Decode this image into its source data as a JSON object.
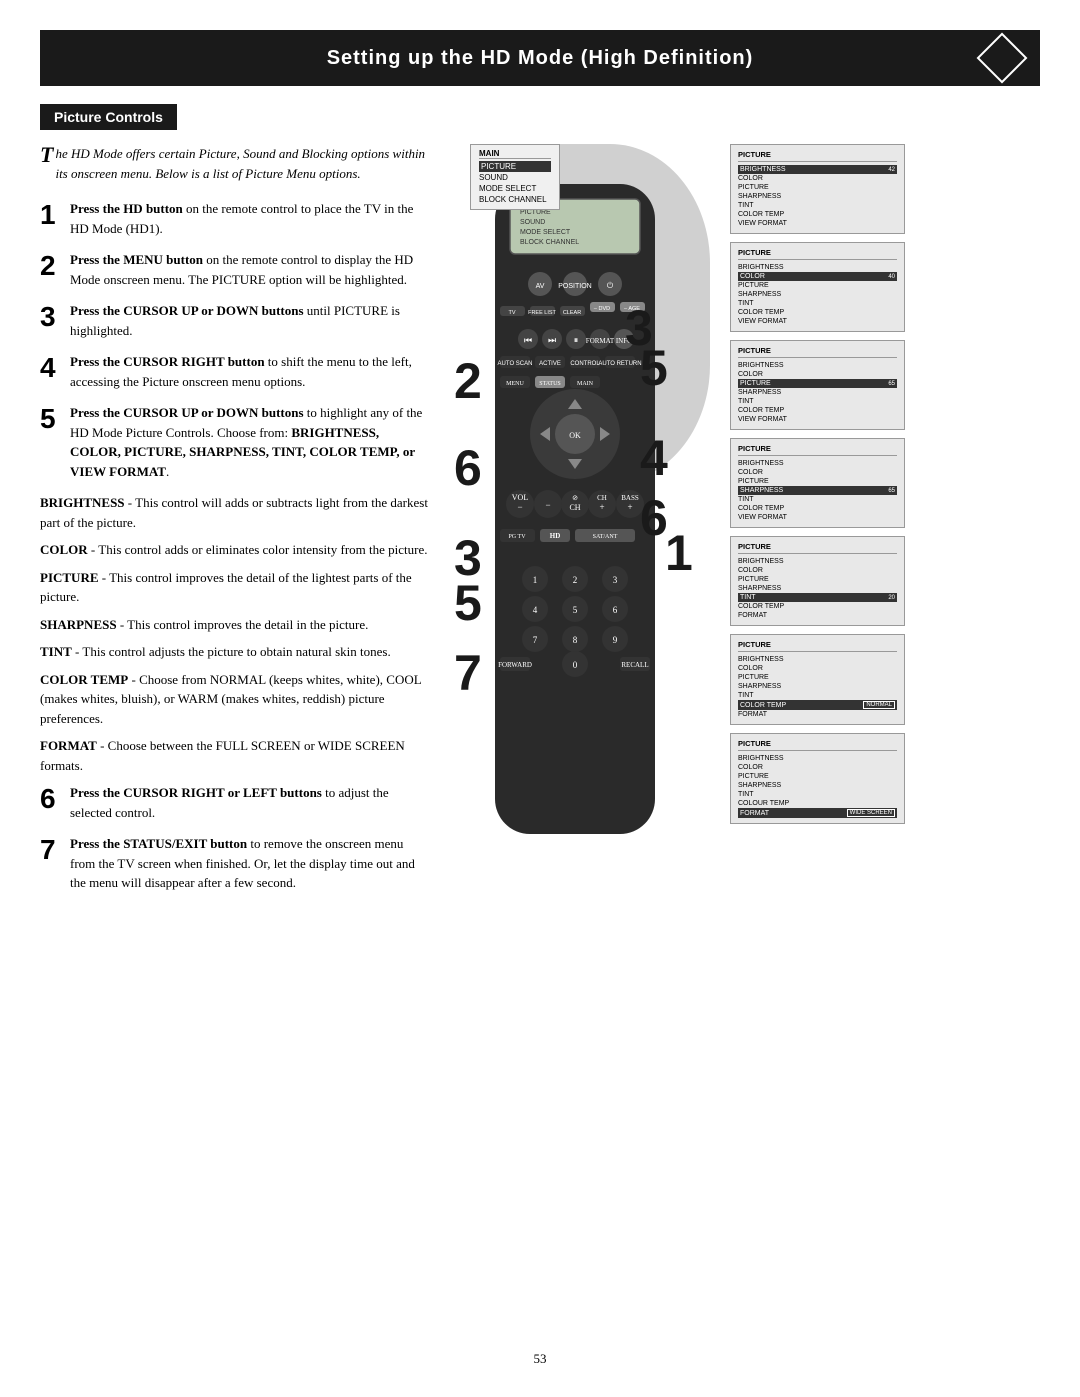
{
  "title": {
    "text": "Setting up the HD Mode (High Definition)",
    "diamond_label": "diamond"
  },
  "section_header": "Picture Controls",
  "intro": {
    "drop_cap": "T",
    "text": "he HD Mode offers certain Picture, Sound and Blocking options within its onscreen menu. Below is a list of Picture Menu options."
  },
  "steps": [
    {
      "number": "1",
      "text": "Press the HD button on the remote control to place the TV in the HD Mode (HD1)."
    },
    {
      "number": "2",
      "text": "Press the MENU button on the remote control to display the HD Mode onscreen menu. The PICTURE option will be highlighted."
    },
    {
      "number": "3",
      "bold_part": "Press the CURSOR UP or DOWN",
      "rest": " buttons until PICTURE is highlighted."
    },
    {
      "number": "4",
      "bold_part": "Press the CURSOR RIGHT button",
      "rest": " to shift the menu to the left, accessing the Picture onscreen menu options."
    },
    {
      "number": "5",
      "bold_part": "Press the CURSOR UP or DOWN",
      "rest_1": " buttons to highlight any of the HD Mode Picture Controls. Choose from: ",
      "bold_part2": "BRIGHTNESS, COLOR, PICTURE, SHARPNESS, TINT, COLOR TEMP, or VIEW FORMAT",
      "rest_2": "."
    }
  ],
  "descriptions": [
    {
      "bold": "BRIGHTNESS",
      "text": " - This control will adds or subtracts light from the darkest part of the picture."
    },
    {
      "bold": "COLOR",
      "text": " - This control adds or eliminates color intensity from the picture."
    },
    {
      "bold": "PICTURE",
      "text": " - This control improves the detail of the lightest parts of the picture."
    },
    {
      "bold": "SHARPNESS",
      "text": " - This control improves the detail in the picture."
    },
    {
      "bold": "TINT",
      "text": " - This control adjusts the picture to obtain natural skin tones."
    },
    {
      "bold": "COLOR TEMP",
      "text": " - Choose from NORMAL (keeps whites, white), COOL (makes whites, bluish), or WARM (makes whites, reddish) picture preferences."
    },
    {
      "bold": "FORMAT",
      "text": " - Choose between the FULL SCREEN or WIDE SCREEN formats."
    }
  ],
  "steps_lower": [
    {
      "number": "6",
      "bold_part": "Press the CURSOR RIGHT or LEFT",
      "rest": " buttons to adjust the selected control."
    },
    {
      "number": "7",
      "bold_part": "Press the STATUS/EXIT button",
      "rest": " to remove the onscreen menu from the TV screen when finished. Or, let the display time out and the menu will disappear after a few second."
    }
  ],
  "page_number": "53",
  "main_menu": {
    "title": "MAIN",
    "items": [
      "PICTURE",
      "SOUND",
      "MODE SELECT",
      "BLOCK CHANNEL"
    ],
    "highlighted": "PICTURE"
  },
  "tv_screens": [
    {
      "title": "PICTURE",
      "items": [
        {
          "label": "BRIGHTNESS",
          "bar": 42,
          "highlighted": true
        },
        {
          "label": "COLOR",
          "bar": 0
        },
        {
          "label": "PICTURE",
          "bar": 0
        },
        {
          "label": "SHARPNESS",
          "bar": 0
        },
        {
          "label": "TINT",
          "bar": 0
        },
        {
          "label": "COLOR TEMP",
          "bar": 0
        },
        {
          "label": "VIEW FORMAT",
          "bar": 0
        }
      ]
    },
    {
      "title": "PICTURE",
      "items": [
        {
          "label": "BRIGHTNESS",
          "bar": 0
        },
        {
          "label": "COLOR",
          "bar": 40,
          "highlighted": true
        },
        {
          "label": "PICTURE",
          "bar": 0
        },
        {
          "label": "SHARPNESS",
          "bar": 0
        },
        {
          "label": "TINT",
          "bar": 0
        },
        {
          "label": "COLOR TEMP",
          "bar": 0
        },
        {
          "label": "VIEW FORMAT",
          "bar": 0
        }
      ]
    },
    {
      "title": "PICTURE",
      "items": [
        {
          "label": "BRIGHTNESS",
          "bar": 0
        },
        {
          "label": "COLOR",
          "bar": 0
        },
        {
          "label": "PICTURE",
          "bar": 65,
          "highlighted": true
        },
        {
          "label": "SHARPNESS",
          "bar": 0
        },
        {
          "label": "TINT",
          "bar": 0
        },
        {
          "label": "COLOR TEMP",
          "bar": 0
        },
        {
          "label": "VIEW FORMAT",
          "bar": 0
        }
      ]
    },
    {
      "title": "PICTURE",
      "items": [
        {
          "label": "BRIGHTNESS",
          "bar": 0
        },
        {
          "label": "COLOR",
          "bar": 0
        },
        {
          "label": "PICTURE",
          "bar": 0
        },
        {
          "label": "SHARPNESS",
          "bar": 65,
          "highlighted": true
        },
        {
          "label": "TINT",
          "bar": 0
        },
        {
          "label": "COLOR TEMP",
          "bar": 0
        },
        {
          "label": "VIEW FORMAT",
          "bar": 0
        }
      ]
    },
    {
      "title": "PICTURE",
      "items": [
        {
          "label": "BRIGHTNESS",
          "bar": 0
        },
        {
          "label": "COLOR",
          "bar": 0
        },
        {
          "label": "PICTURE",
          "bar": 0
        },
        {
          "label": "SHARPNESS",
          "bar": 0
        },
        {
          "label": "TINT",
          "bar": 20,
          "highlighted": true
        },
        {
          "label": "COLOR TEMP",
          "bar": 0
        },
        {
          "label": "FORMAT",
          "bar": 0
        }
      ]
    },
    {
      "title": "PICTURE",
      "items": [
        {
          "label": "BRIGHTNESS",
          "bar": 0
        },
        {
          "label": "COLOR",
          "bar": 0
        },
        {
          "label": "PICTURE",
          "bar": 0
        },
        {
          "label": "SHARPNESS",
          "bar": 0
        },
        {
          "label": "TINT",
          "bar": 0
        },
        {
          "label": "COLOR TEMP",
          "bar": 0,
          "text_val": "NORMAL",
          "highlighted": true
        },
        {
          "label": "FORMAT",
          "bar": 0
        }
      ]
    },
    {
      "title": "PICTURE",
      "items": [
        {
          "label": "BRIGHTNESS",
          "bar": 0
        },
        {
          "label": "COLOR",
          "bar": 0
        },
        {
          "label": "PICTURE",
          "bar": 0
        },
        {
          "label": "SHARPNESS",
          "bar": 0
        },
        {
          "label": "TINT",
          "bar": 0
        },
        {
          "label": "COLOUR TEMP",
          "bar": 0
        },
        {
          "label": "FORMAT",
          "bar": 0,
          "text_val": "WIDE SCREEN",
          "highlighted": true
        }
      ]
    }
  ],
  "remote_big_numbers": [
    "2",
    "3",
    "4",
    "5",
    "6",
    "7",
    "1",
    "3",
    "5",
    "6"
  ]
}
